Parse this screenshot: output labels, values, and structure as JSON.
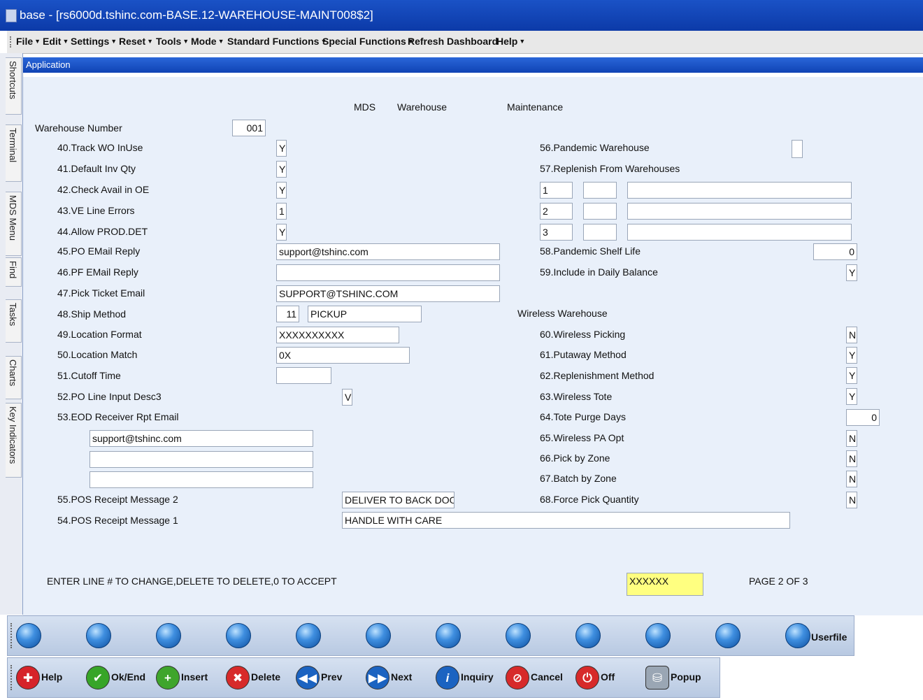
{
  "window": {
    "title": "base - [rs6000d.tshinc.com-BASE.12-WAREHOUSE-MAINT008$2]"
  },
  "menu": [
    "File",
    "Edit",
    "Settings",
    "Reset",
    "Tools",
    "Mode",
    "Standard Functions",
    "Special Functions",
    "Refresh Dashboard",
    "Help"
  ],
  "sidebar_tabs": [
    "Shortcuts",
    "Terminal",
    "MDS Menu",
    "Find",
    "Tasks",
    "Charts",
    "Key Indicators"
  ],
  "app_header": "Application",
  "form": {
    "heading": [
      "MDS",
      "Warehouse",
      "Maintenance"
    ],
    "warehouse_number_label": "Warehouse Number",
    "warehouse_number": "001",
    "f40_label": "40.Track WO InUse",
    "f40": "Y",
    "f41_label": "41.Default Inv Qty",
    "f41": "Y",
    "f42_label": "42.Check Avail in OE",
    "f42": "Y",
    "f43_label": "43.VE Line Errors",
    "f43": "1",
    "f44_label": "44.Allow PROD.DET",
    "f44": "Y",
    "f45_label": "45.PO EMail Reply",
    "f45": "support@tshinc.com",
    "f46_label": "46.PF EMail Reply",
    "f46": "",
    "f47_label": "47.Pick Ticket Email",
    "f47": "SUPPORT@TSHINC.COM",
    "f48_label": "48.Ship Method",
    "f48_code": "11",
    "f48_desc": "PICKUP",
    "f49_label": "49.Location Format",
    "f49": "XXXXXXXXXX",
    "f50_label": "50.Location Match",
    "f50": "0X",
    "f51_label": "51.Cutoff Time",
    "f51": "",
    "f52_label": "52.PO Line Input Desc3",
    "f52": "V",
    "f53_label": "53.EOD Receiver Rpt Email",
    "f53_emails": [
      "support@tshinc.com",
      "",
      ""
    ],
    "f55_label": "55.POS Receipt Message 2",
    "f55": "DELIVER TO BACK DOOR ON",
    "f54_label": "54.POS Receipt Message 1",
    "f54": "HANDLE WITH CARE",
    "f56_label": "56.Pandemic Warehouse",
    "f56": "",
    "f57_label": "57.Replenish From Warehouses",
    "f57_rows": [
      {
        "seq": "1",
        "whse": "",
        "desc": ""
      },
      {
        "seq": "2",
        "whse": "",
        "desc": ""
      },
      {
        "seq": "3",
        "whse": "",
        "desc": ""
      }
    ],
    "f58_label": "58.Pandemic Shelf Life",
    "f58": "0",
    "f59_label": "59.Include in Daily Balance",
    "f59": "Y",
    "wireless_heading": "Wireless Warehouse",
    "f60_label": "60.Wireless Picking",
    "f60": "N",
    "f61_label": "61.Putaway Method",
    "f61": "Y",
    "f62_label": "62.Replenishment Method",
    "f62": "Y",
    "f63_label": "63.Wireless Tote",
    "f63": "Y",
    "f64_label": "64.Tote Purge Days",
    "f64": "0",
    "f65_label": "65.Wireless PA Opt",
    "f65": "N",
    "f66_label": "66.Pick by Zone",
    "f66": "N",
    "f67_label": "67.Batch by Zone",
    "f67": "N",
    "f68_label": "68.Force Pick Quantity",
    "f68": "N",
    "prompt": "ENTER LINE # TO CHANGE,DELETE TO DELETE,0 TO ACCEPT",
    "input_value": "XXXXXX",
    "page": "PAGE  2 OF  3"
  },
  "toolbar_top": {
    "userfile": "Userfile"
  },
  "toolbar_bottom": [
    "Help",
    "Ok/End",
    "Insert",
    "Delete",
    "Prev",
    "Next",
    "Inquiry",
    "Cancel",
    "Off",
    "Popup"
  ],
  "colors": {
    "title_bar": "#0c3aa8",
    "form_bg": "#e9f0fa",
    "highlight_field": "#ffff80"
  }
}
